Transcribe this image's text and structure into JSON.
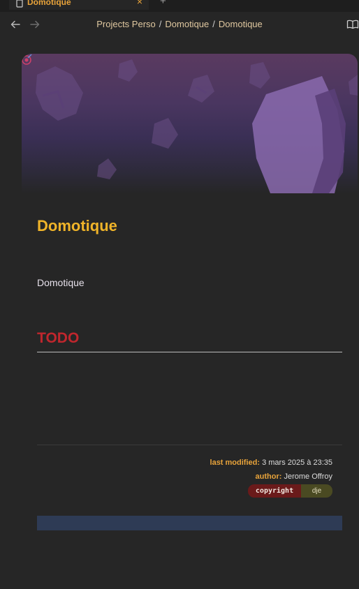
{
  "tabs": {
    "active": {
      "title": "Domotique",
      "close_glyph": "×"
    },
    "new_tab_glyph": "+",
    "menu_glyph": "⌄"
  },
  "nav": {
    "back_icon": "arrow-left-icon",
    "forward_icon": "arrow-right-icon",
    "reader_icon": "book-open-icon",
    "breadcrumb": [
      "Projects Perso",
      "Domotique",
      "Domotique"
    ],
    "separator": "/"
  },
  "page": {
    "title": "Domotique",
    "subtitle": "Domotique",
    "section_heading": "TODO"
  },
  "footer": {
    "last_modified_label": "last modified:",
    "last_modified_value": "3 mars 2025 à 23:35",
    "author_label": "author:",
    "author_value": "Jerome Offroy",
    "license_key": "copyright",
    "license_value": "dje"
  },
  "colors": {
    "accent": "#f0b429",
    "todo": "#c0262d",
    "background": "#262626",
    "banner_top": "#5a3a60",
    "bottom_bar": "#2e3b55"
  }
}
